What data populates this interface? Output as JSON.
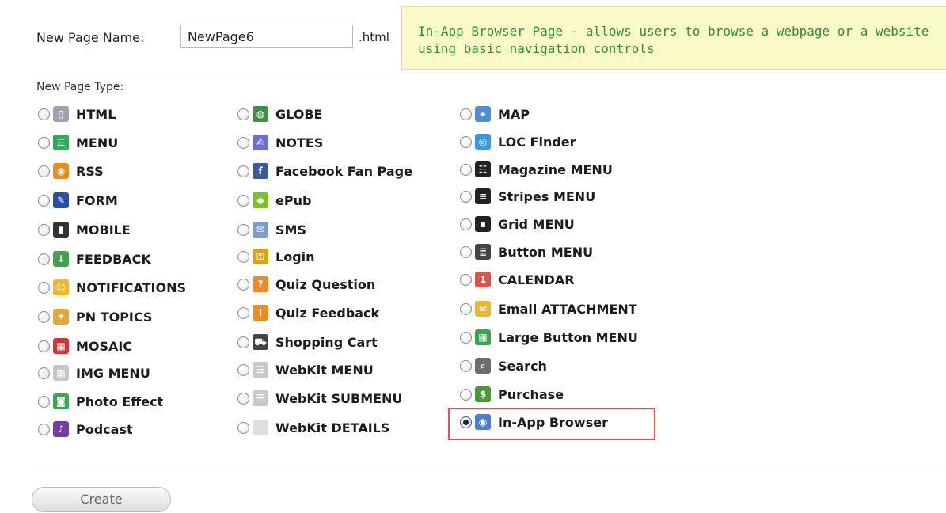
{
  "form": {
    "name_label": "New Page Name:",
    "name_value": "NewPage6",
    "extension": ".html",
    "info_text": "In-App Browser Page - allows users to browse a webpage or a website using basic navigation controls",
    "type_label": "New Page Type:",
    "create_label": "Create"
  },
  "columns": [
    [
      {
        "label": "HTML",
        "icon": "html-page-icon",
        "glyph": "▯",
        "color": "#9aa3ad"
      },
      {
        "label": "MENU",
        "icon": "menu-list-icon",
        "glyph": "☰",
        "color": "#2eaa5a"
      },
      {
        "label": "RSS",
        "icon": "rss-feed-icon",
        "glyph": "◉",
        "color": "#f18a1c"
      },
      {
        "label": "FORM",
        "icon": "pencil-icon",
        "glyph": "✎",
        "color": "#2b4fa6"
      },
      {
        "label": "MOBILE",
        "icon": "mobile-phone-icon",
        "glyph": "▮",
        "color": "#333333"
      },
      {
        "label": "FEEDBACK",
        "icon": "feedback-download-icon",
        "glyph": "↓",
        "color": "#3fa34d"
      },
      {
        "label": "NOTIFICATIONS",
        "icon": "smiley-notification-icon",
        "glyph": "☺",
        "color": "#f4b628"
      },
      {
        "label": "PN TOPICS",
        "icon": "push-topics-icon",
        "glyph": "✦",
        "color": "#e2a73a"
      },
      {
        "label": "MOSAIC",
        "icon": "mosaic-tiles-icon",
        "glyph": "▦",
        "color": "#d83232"
      },
      {
        "label": "IMG MENU",
        "icon": "image-grid-icon",
        "glyph": "▦",
        "color": "#c6c6c6"
      },
      {
        "label": "Photo Effect",
        "icon": "camera-icon",
        "glyph": "◙",
        "color": "#3aa655"
      },
      {
        "label": "Podcast",
        "icon": "microphone-icon",
        "glyph": "♪",
        "color": "#7b3ba6"
      }
    ],
    [
      {
        "label": "GLOBE",
        "icon": "globe-icon",
        "glyph": "◍",
        "color": "#3f8f4a"
      },
      {
        "label": "NOTES",
        "icon": "notes-pencil-icon",
        "glyph": "✍",
        "color": "#6c6ed6"
      },
      {
        "label": "Facebook Fan Page",
        "icon": "facebook-icon",
        "glyph": "f",
        "color": "#3b5998"
      },
      {
        "label": "ePub",
        "icon": "epub-icon",
        "glyph": "◆",
        "color": "#7bbf2a"
      },
      {
        "label": "SMS",
        "icon": "envelope-icon",
        "glyph": "✉",
        "color": "#7d9cc8"
      },
      {
        "label": "Login",
        "icon": "padlock-icon",
        "glyph": "⚿",
        "color": "#d9a416"
      },
      {
        "label": "Quiz Question",
        "icon": "quiz-question-icon",
        "glyph": "?",
        "color": "#ee8a26"
      },
      {
        "label": "Quiz Feedback",
        "icon": "quiz-feedback-icon",
        "glyph": "!",
        "color": "#ee8a26"
      },
      {
        "label": "Shopping Cart",
        "icon": "shopping-cart-icon",
        "glyph": "⛟",
        "color": "#444444"
      },
      {
        "label": "WebKit MENU",
        "icon": "webkit-menu-icon",
        "glyph": "☰",
        "color": "#c9c9c9"
      },
      {
        "label": "WebKit SUBMENU",
        "icon": "webkit-submenu-icon",
        "glyph": "☰",
        "color": "#c9c9c9"
      },
      {
        "label": "WebKit DETAILS",
        "icon": "webkit-details-icon",
        "glyph": " ",
        "color": "#dedede"
      }
    ],
    [
      {
        "label": "MAP",
        "icon": "map-icon",
        "glyph": "⌖",
        "color": "#4f8fd0"
      },
      {
        "label": "LOC Finder",
        "icon": "location-finder-icon",
        "glyph": "◎",
        "color": "#3a9ad9"
      },
      {
        "label": "Magazine MENU",
        "icon": "magazine-menu-icon",
        "glyph": "☷",
        "color": "#222222"
      },
      {
        "label": "Stripes MENU",
        "icon": "stripes-menu-icon",
        "glyph": "≡",
        "color": "#222222"
      },
      {
        "label": "Grid MENU",
        "icon": "grid-menu-icon",
        "glyph": "▪",
        "color": "#222222"
      },
      {
        "label": "Button MENU",
        "icon": "button-menu-icon",
        "glyph": "≣",
        "color": "#444444"
      },
      {
        "label": "CALENDAR",
        "icon": "calendar-icon",
        "glyph": "1",
        "color": "#d9534f"
      },
      {
        "label": "Email ATTACHMENT",
        "icon": "email-attachment-icon",
        "glyph": "✉",
        "color": "#e8b92e"
      },
      {
        "label": "Large Button MENU",
        "icon": "large-button-grid-icon",
        "glyph": "▦",
        "color": "#3aa655"
      },
      {
        "label": "Search",
        "icon": "search-magnifier-icon",
        "glyph": "⌕",
        "color": "#6d6d6d"
      },
      {
        "label": "Purchase",
        "icon": "dollar-icon",
        "glyph": "$",
        "color": "#4a9a3a"
      },
      {
        "label": "In-App Browser",
        "icon": "browser-compass-icon",
        "glyph": "◉",
        "color": "#4a7fd0",
        "checked": true
      }
    ]
  ]
}
